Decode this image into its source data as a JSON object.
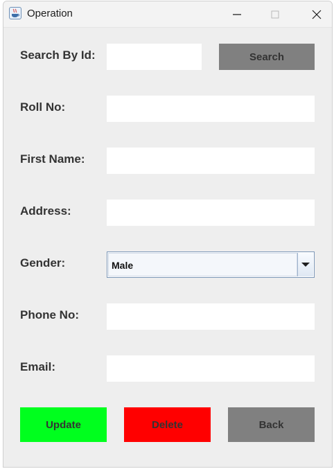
{
  "window": {
    "title": "Operation"
  },
  "form": {
    "search_label": "Search By Id:",
    "search_value": "",
    "search_button": "Search",
    "roll_label": "Roll No:",
    "roll_value": "",
    "first_name_label": "First Name:",
    "first_name_value": "",
    "address_label": "Address:",
    "address_value": "",
    "gender_label": "Gender:",
    "gender_selected": "Male",
    "phone_label": "Phone No:",
    "phone_value": "",
    "email_label": "Email:",
    "email_value": ""
  },
  "actions": {
    "update": "Update",
    "delete": "Delete",
    "back": "Back"
  },
  "colors": {
    "update_bg": "#00ff1e",
    "delete_bg": "#ff0000",
    "back_bg": "#808080",
    "search_bg": "#808080"
  },
  "icons": {
    "app": "java-cup-icon",
    "minimize": "minimize-icon",
    "maximize": "maximize-icon",
    "close": "close-icon",
    "dropdown": "chevron-down-icon"
  }
}
